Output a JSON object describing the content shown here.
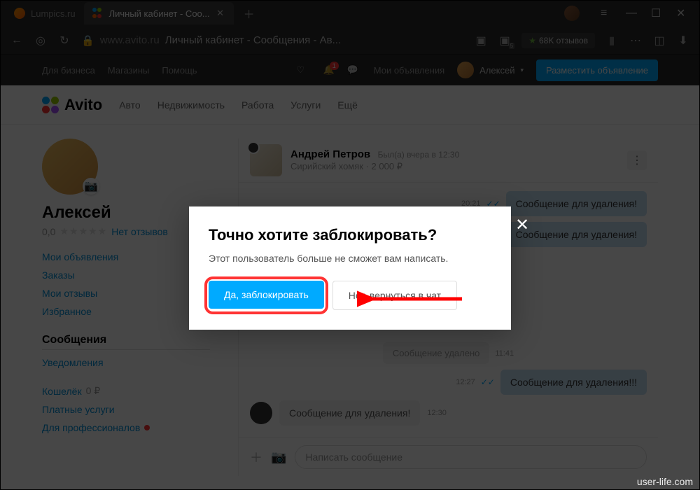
{
  "browser": {
    "tabs": [
      {
        "title": "Lumpics.ru"
      },
      {
        "title": "Личный кабинет - Соо..."
      }
    ],
    "url_host": "www.avito.ru",
    "url_title": "Личный кабинет - Сообщения - Ав...",
    "rating_badge": "68K отзывов",
    "ext_count": "5"
  },
  "top_bar": {
    "business": "Для бизнеса",
    "shops": "Магазины",
    "help": "Помощь",
    "my_ads": "Мои объявления",
    "badge_count": "1",
    "username": "Алексей",
    "post_btn": "Разместить объявление"
  },
  "nav": {
    "brand": "Avito",
    "items": [
      "Авто",
      "Недвижимость",
      "Работа",
      "Услуги",
      "Ещё"
    ]
  },
  "sidebar": {
    "name": "Алексей",
    "rating": "0,0",
    "no_reviews": "Нет отзывов",
    "links": [
      "Мои объявления",
      "Заказы",
      "Мои отзывы",
      "Избранное"
    ],
    "messages_title": "Сообщения",
    "notifications": "Уведомления",
    "wallet_label": "Кошелёк",
    "wallet_value": "0 ₽",
    "paid": "Платные услуги",
    "pro": "Для профессионалов"
  },
  "chat": {
    "name": "Андрей Петров",
    "seen": "Был(а) вчера в 12:30",
    "item": "Сирийский хомяк",
    "price": "2 000 ₽",
    "placeholder": "Написать сообщение",
    "messages": {
      "m1_time": "20:21",
      "m1_text": "Сообщение для удаления!",
      "m2_text": "Сообщение для удаления!",
      "deleted": "Сообщение удалено",
      "deleted_time": "11:41",
      "m3_time": "12:27",
      "m3_text": "Сообщение для удаления!!!",
      "m4_text": "Сообщение для удаления!",
      "m4_time": "12:30"
    }
  },
  "modal": {
    "title": "Точно хотите заблокировать?",
    "text": "Этот пользователь больше не сможет вам написать.",
    "confirm": "Да, заблокировать",
    "cancel": "Нет, вернуться в чат"
  },
  "watermark": "user-life.com"
}
